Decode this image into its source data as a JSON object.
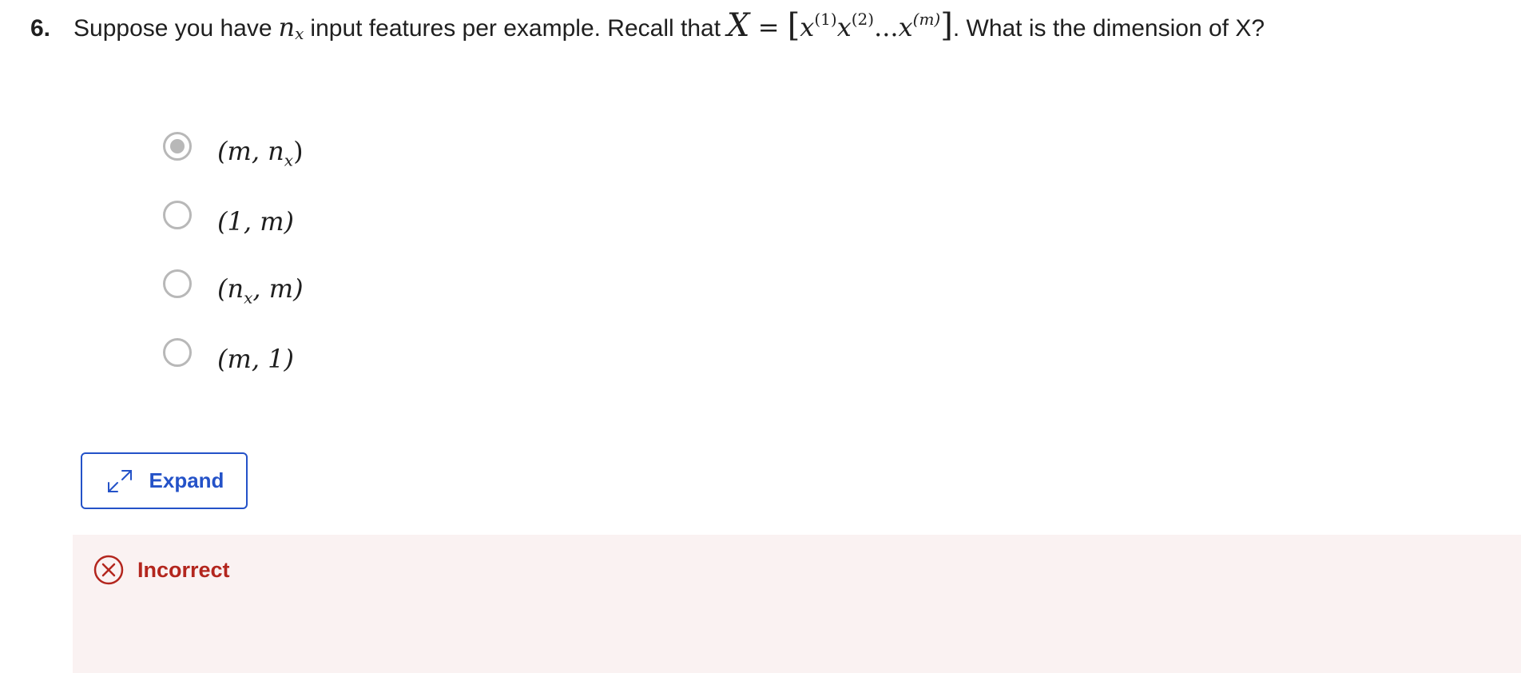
{
  "question": {
    "number": "6.",
    "text_before": "Suppose you have",
    "var_n": "n",
    "var_n_sub": "x",
    "text_middle": "input features per example. Recall that",
    "X_symbol": "X",
    "equals": "=",
    "bracket_open": "[",
    "x_symbol": "x",
    "sup_1": "(1)",
    "sup_2": "(2)",
    "dots": "...",
    "sup_m": "(m)",
    "bracket_close": "]",
    "text_after": ". What is the dimension of X?"
  },
  "options": [
    {
      "label": "(m, n",
      "sub": "x",
      "tail": ")",
      "selected": true
    },
    {
      "label": "(1, m)",
      "sub": "",
      "tail": "",
      "selected": false
    },
    {
      "label": "(n",
      "sub": "x",
      "tail": ", m)",
      "selected": false
    },
    {
      "label": "(m, 1)",
      "sub": "",
      "tail": "",
      "selected": false
    }
  ],
  "expand_button": {
    "label": "Expand",
    "icon": "expand-arrows-icon"
  },
  "feedback": {
    "status": "Incorrect",
    "icon": "x-circle-icon",
    "color": "#b3261e",
    "background": "#faf2f2"
  },
  "colors": {
    "accent": "#2452c8",
    "radio_border": "#b8b8b8"
  }
}
